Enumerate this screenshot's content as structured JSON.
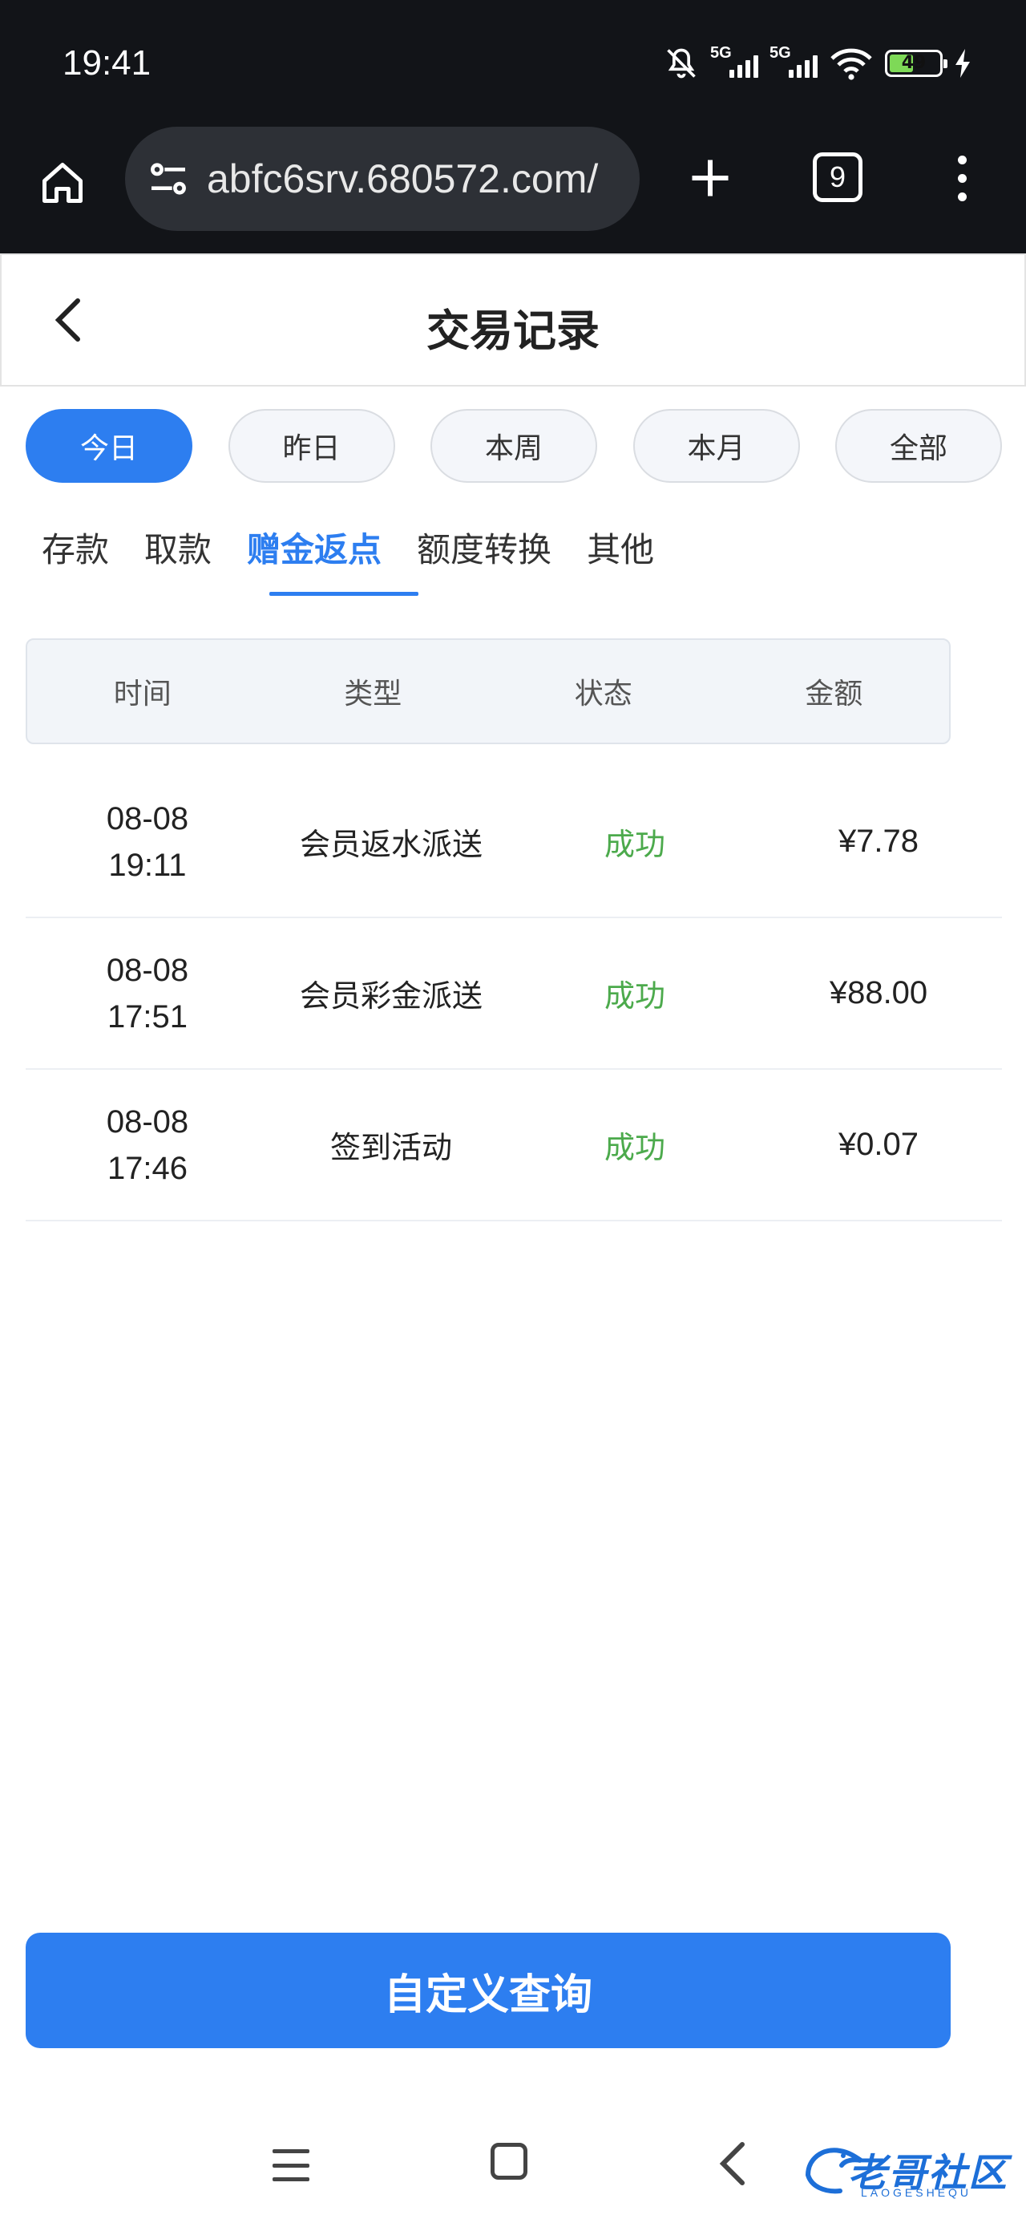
{
  "status_bar": {
    "time": "19:41",
    "network_1": "5G",
    "network_2": "5G",
    "battery": "49",
    "battery_level": 0.49
  },
  "browser": {
    "url": "abfc6srv.680572.com/",
    "tab_count": "9"
  },
  "header": {
    "title": "交易记录"
  },
  "date_filters": [
    {
      "label": "今日",
      "active": true
    },
    {
      "label": "昨日",
      "active": false
    },
    {
      "label": "本周",
      "active": false
    },
    {
      "label": "本月",
      "active": false
    },
    {
      "label": "全部",
      "active": false
    }
  ],
  "categories": [
    {
      "label": "存款",
      "active": false
    },
    {
      "label": "取款",
      "active": false
    },
    {
      "label": "赠金返点",
      "active": true
    },
    {
      "label": "额度转换",
      "active": false
    },
    {
      "label": "其他",
      "active": false
    }
  ],
  "table": {
    "columns": [
      "时间",
      "类型",
      "状态",
      "金额"
    ],
    "rows": [
      {
        "date": "08-08",
        "time": "19:11",
        "type": "会员返水派送",
        "status": "成功",
        "amount": "¥7.78"
      },
      {
        "date": "08-08",
        "time": "17:51",
        "type": "会员彩金派送",
        "status": "成功",
        "amount": "¥88.00"
      },
      {
        "date": "08-08",
        "time": "17:46",
        "type": "签到活动",
        "status": "成功",
        "amount": "¥0.07"
      }
    ]
  },
  "actions": {
    "custom_query": "自定义查询"
  },
  "watermark": {
    "text": "老哥社区",
    "sub": "LAOGESHEQU"
  },
  "colors": {
    "accent": "#2d7ef0",
    "success": "#4caa4c",
    "status_bar_bg": "#121418"
  }
}
